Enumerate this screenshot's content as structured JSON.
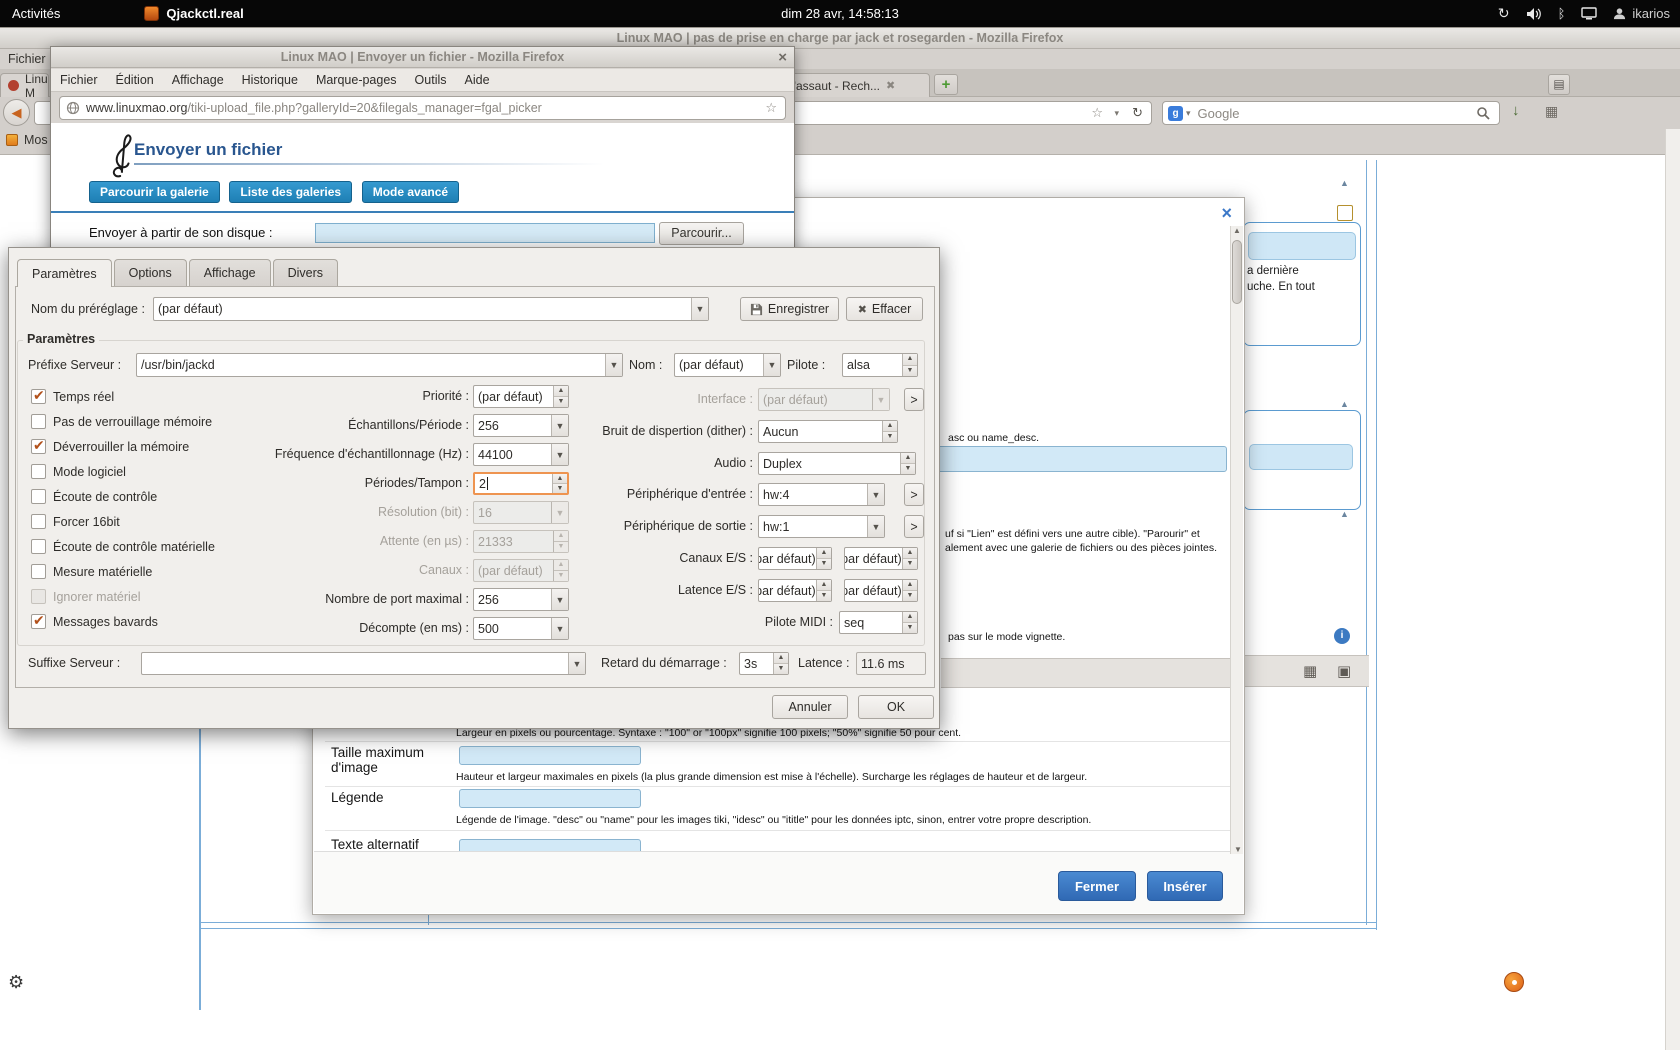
{
  "topbar": {
    "activities": "Activités",
    "app_name": "Qjackctl.real",
    "clock": "dim 28 avr, 14:58:13",
    "user": "ikarios"
  },
  "main_window": {
    "title": "Linux MAO | pas de prise en charge par jack et rosegarden - Mozilla Firefox",
    "menu_file": "Fichier",
    "tab1": "Linux M",
    "tab2": "d'assaut - Rech...",
    "new_tab": "+",
    "bookmark": "Mos",
    "search_engine": "Google",
    "right_col": {
      "line1": "a dernière",
      "line2": "uche. En tout"
    }
  },
  "upload_window": {
    "title": "Linux MAO | Envoyer un fichier - Mozilla Firefox",
    "menus": [
      "Fichier",
      "Édition",
      "Affichage",
      "Historique",
      "Marque-pages",
      "Outils",
      "Aide"
    ],
    "url_domain": "www.linuxmao.org",
    "url_path": "/tiki-upload_file.php?galleryId=20&filegals_manager=fgal_picker",
    "heading": "Envoyer un fichier",
    "btn_browse_gallery": "Parcourir la galerie",
    "btn_list_galleries": "Liste des galeries",
    "btn_advanced": "Mode avancé",
    "upload_label": "Envoyer à partir de son disque :",
    "browse_button": "Parcourir..."
  },
  "dialog": {
    "tabs": [
      "Paramètres",
      "Options",
      "Affichage",
      "Divers"
    ],
    "preset": {
      "label": "Nom du préréglage :",
      "value": "(par défaut)",
      "save": "Enregistrer",
      "delete": "Effacer"
    },
    "group": "Paramètres",
    "server": {
      "prefix_label": "Préfixe Serveur :",
      "prefix_value": "/usr/bin/jackd",
      "name_label": "Nom :",
      "name_value": "(par défaut)",
      "driver_label": "Pilote :",
      "driver_value": "alsa"
    },
    "checks": [
      {
        "label": "Temps réel",
        "checked": true
      },
      {
        "label": "Pas de verrouillage mémoire",
        "checked": false
      },
      {
        "label": "Déverrouiller la mémoire",
        "checked": true
      },
      {
        "label": "Mode logiciel",
        "checked": false
      },
      {
        "label": "Écoute de contrôle",
        "checked": false
      },
      {
        "label": "Forcer 16bit",
        "checked": false
      },
      {
        "label": "Écoute de contrôle matérielle",
        "checked": false
      },
      {
        "label": "Mesure matérielle",
        "checked": false
      },
      {
        "label": "Ignorer matériel",
        "checked": false
      },
      {
        "label": "Messages bavards",
        "checked": true
      }
    ],
    "mid": [
      {
        "label": "Priorité :",
        "value": "(par défaut)"
      },
      {
        "label": "Échantillons/Période :",
        "value": "256"
      },
      {
        "label": "Fréquence d'échantillonnage (Hz) :",
        "value": "44100"
      },
      {
        "label": "Périodes/Tampon :",
        "value": "2"
      },
      {
        "label": "Résolution (bit) :",
        "value": "16"
      },
      {
        "label": "Attente (en µs) :",
        "value": "21333"
      },
      {
        "label": "Canaux :",
        "value": "(par défaut)"
      },
      {
        "label": "Nombre de port maximal :",
        "value": "256"
      },
      {
        "label": "Décompte (en ms) :",
        "value": "500"
      }
    ],
    "right": {
      "interface_label": "Interface :",
      "interface_value": "(par défaut)",
      "dither_label": "Bruit de dispertion (dither) :",
      "dither_value": "Aucun",
      "audio_label": "Audio :",
      "audio_value": "Duplex",
      "in_label": "Périphérique d'entrée :",
      "in_value": "hw:4",
      "out_label": "Périphérique de sortie :",
      "out_value": "hw:1",
      "ioch_label": "Canaux E/S :",
      "ioch_value1": "(par défaut)",
      "ioch_value2": "(par défaut)",
      "iolat_label": "Latence E/S :",
      "iolat_value1": "(par défaut)",
      "iolat_value2": "(par défaut)",
      "midi_label": "Pilote MIDI :",
      "midi_value": "seq",
      "more": ">"
    },
    "bottom": {
      "suffix_label": "Suffixe Serveur :",
      "delay_label": "Retard du démarrage :",
      "delay_value": "3s",
      "latency_label": "Latence :",
      "latency_value": "11.6 ms"
    },
    "buttons": {
      "cancel": "Annuler",
      "ok": "OK"
    }
  },
  "modal": {
    "close": "×",
    "frag_sort": "asc ou name_desc.",
    "frag_link1": "uf si \"Lien\" est défini vers une autre cible). \"Parourir\" et",
    "frag_link2": "alement avec une galerie de fichiers ou des pièces jointes.",
    "frag_vignette": "pas sur le mode vignette.",
    "width_desc": "Largeur en pixels ou pourcentage. Syntaxe : \"100\" or \"100px\" signifie 100 pixels; \"50%\" signifie 50 pour cent.",
    "row1_label": "Taille maximum d'image",
    "row1_desc": "Hauteur et largeur maximales en pixels (la plus grande dimension est mise à l'échelle). Surcharge les réglages de hauteur et de largeur.",
    "row2_label": "Légende",
    "row2_desc": "Légende de l'image. \"desc\" ou \"name\" pour les images tiki, \"idesc\" ou \"ititle\" pour les données iptc, sinon, entrer votre propre description.",
    "row3_label": "Texte alternatif",
    "close_button": "Fermer",
    "insert_button": "Insérer"
  }
}
